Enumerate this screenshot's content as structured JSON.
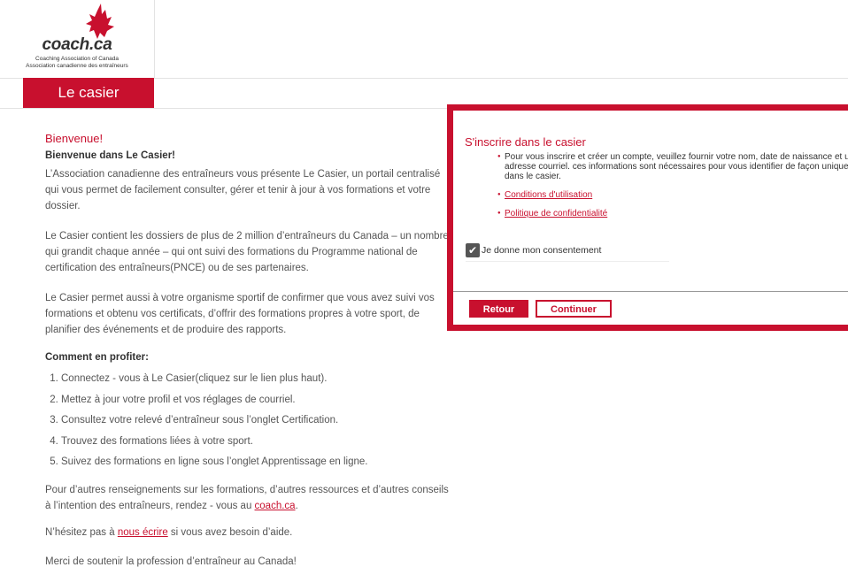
{
  "header": {
    "logo_word": "coach.ca",
    "logo_sub1": "Coaching Association of Canada",
    "logo_sub2": "Association canadienne des entraîneurs",
    "logo_icon": "maple-leaf-icon",
    "tab_label": "Le casier"
  },
  "main": {
    "welcome_title": "Bienvenue!",
    "welcome_subtitle": "Bienvenue dans Le Casier!",
    "para1": "L’Association canadienne des entraîneurs vous présente Le Casier, un portail centralisé qui vous permet de facilement consulter, gérer et tenir à jour à vos formations et votre dossier.",
    "para2": "Le Casier contient les dossiers de plus de 2 million d’entraîneurs du Canada – un nombre qui grandit chaque année – qui ont suivi des formations du Programme national de certification des entraîneurs(PNCE) ou de ses partenaires.",
    "para3": "Le Casier permet aussi à votre organisme sportif de confirmer que vous avez suivi vos formations et obtenu vos certificats, d’offrir des formations propres à votre sport, de planifier des événements et de produire des rapports.",
    "howto_title": "Comment en profiter:",
    "steps": [
      "Connectez - vous à Le Casier(cliquez sur le lien plus haut).",
      "Mettez à jour votre profil et vos réglages de courriel.",
      "Consultez votre relevé d’entraîneur sous l’onglet Certification.",
      "Trouvez des formations liées à votre sport.",
      "Suivez des formations en ligne sous l’onglet Apprentissage en ligne."
    ],
    "para4_before": "Pour d’autres renseignements sur les formations, d’autres ressources et d’autres conseils à l’intention des entraîneurs, rendez - vous au ",
    "para4_link": "coach.ca",
    "para4_after": ".",
    "para5_before": "N’hésitez pas à ",
    "para5_link": "nous écrire",
    "para5_after": " si vous avez besoin d’aide.",
    "para6": "Merci de soutenir la profession d’entraîneur au Canada!"
  },
  "panel": {
    "title": "S'inscrire dans le casier",
    "info": "Pour vous inscrire et créer un compte, veuillez fournir votre nom, date de naissance et une adresse courriel. ces informations sont nécessaires pour vous identifier de façon unique dans le casier.",
    "terms_link": "Conditions d'utilisation",
    "privacy_link": "Politique de confidentialité",
    "consent_label": "Je donne mon consentement",
    "consent_checked": true,
    "back_label": "Retour",
    "continue_label": "Continuer"
  },
  "colors": {
    "accent": "#c8102e",
    "text": "#555555",
    "dark_text": "#333333"
  }
}
